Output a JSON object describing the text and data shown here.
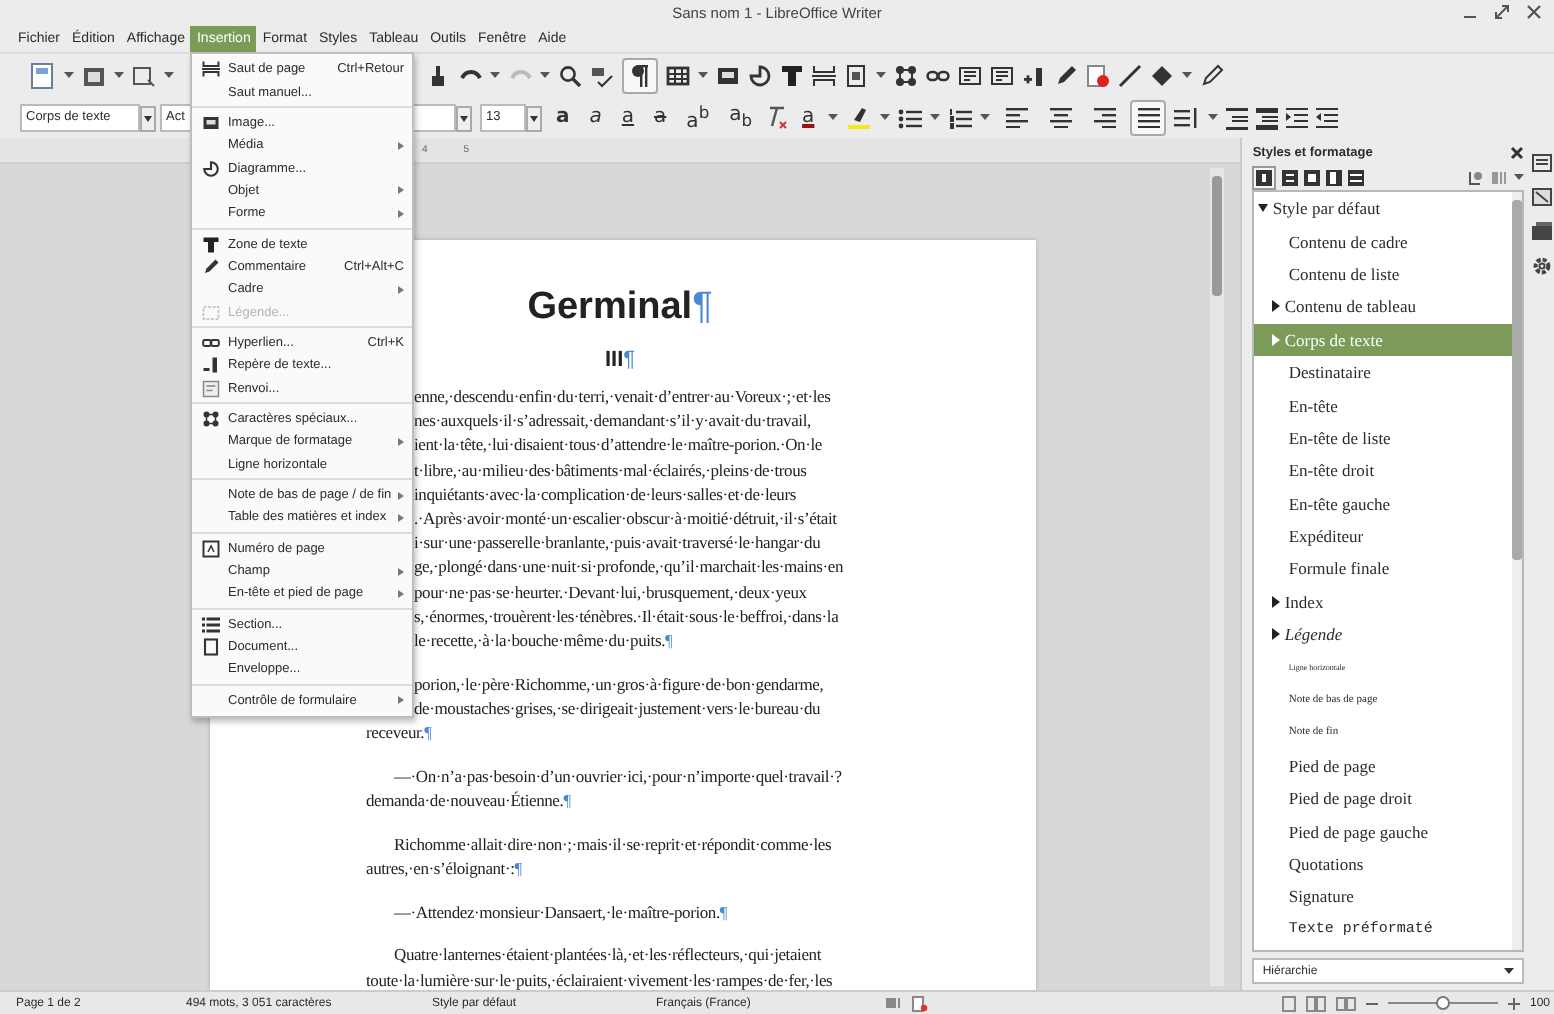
{
  "window": {
    "title": "Sans nom 1 - LibreOffice Writer"
  },
  "menubar": [
    {
      "label": "Fichier",
      "selected": false
    },
    {
      "label": "Édition",
      "selected": false
    },
    {
      "label": "Affichage",
      "selected": false
    },
    {
      "label": "Insertion",
      "selected": true
    },
    {
      "label": "Format",
      "selected": false
    },
    {
      "label": "Styles",
      "selected": false
    },
    {
      "label": "Tableau",
      "selected": false
    },
    {
      "label": "Outils",
      "selected": false
    },
    {
      "label": "Fenêtre",
      "selected": false
    },
    {
      "label": "Aide",
      "selected": false
    }
  ],
  "toolbar": {
    "formatting_marks_on": true,
    "paragraph_style": "Corps de texte",
    "font_name": "Act",
    "font_size": "13",
    "format_buttons": [
      {
        "label": "a",
        "kind": "bold"
      },
      {
        "label": "a",
        "kind": "italic"
      },
      {
        "label": "a",
        "kind": "underline"
      },
      {
        "label": "a",
        "kind": "strike"
      },
      {
        "label": "a$^{b}$",
        "kind": "super"
      },
      {
        "label": "a$_{b}$",
        "kind": "sub"
      },
      {
        "label": "a",
        "kind": "font-color"
      }
    ],
    "align": [
      {
        "kind": "left",
        "selected": false
      },
      {
        "kind": "center",
        "selected": false
      },
      {
        "kind": "right",
        "selected": false
      },
      {
        "kind": "justify",
        "selected": true
      }
    ]
  },
  "ruler": [
    "4",
    "5"
  ],
  "menu": [
    {
      "kind": "pagebreak",
      "label": "Saut de page",
      "shortcut": "Ctrl+Retour",
      "disabled": false
    },
    {
      "kind": "plain",
      "label": "Saut manuel...",
      "disabled": false
    },
    {
      "kind": "separator"
    },
    {
      "kind": "image",
      "label": "Image...",
      "disabled": false
    },
    {
      "kind": "plain",
      "label": "Média",
      "submenu": true,
      "disabled": false
    },
    {
      "kind": "chart",
      "label": "Diagramme...",
      "disabled": false
    },
    {
      "kind": "plain",
      "label": "Objet",
      "submenu": true,
      "disabled": false
    },
    {
      "kind": "plain",
      "label": "Forme",
      "submenu": true,
      "disabled": false
    },
    {
      "kind": "separator"
    },
    {
      "kind": "textbox",
      "label": "Zone de texte",
      "disabled": false
    },
    {
      "kind": "comment",
      "label": "Commentaire",
      "shortcut": "Ctrl+Alt+C",
      "disabled": false
    },
    {
      "kind": "plain",
      "label": "Cadre",
      "submenu": true,
      "disabled": false
    },
    {
      "kind": "caption",
      "label": "Légende...",
      "disabled": true
    },
    {
      "kind": "separator"
    },
    {
      "kind": "link",
      "label": "Hyperlien...",
      "shortcut": "Ctrl+K",
      "disabled": false
    },
    {
      "kind": "bookmark",
      "label": "Repère de texte...",
      "disabled": false
    },
    {
      "kind": "crossref",
      "label": "Renvoi...",
      "disabled": false
    },
    {
      "kind": "separator"
    },
    {
      "kind": "special",
      "label": "Caractères spéciaux...",
      "disabled": false
    },
    {
      "kind": "plain",
      "label": "Marque de formatage",
      "submenu": true,
      "disabled": false
    },
    {
      "kind": "plain",
      "label": "Ligne horizontale",
      "disabled": false
    },
    {
      "kind": "separator"
    },
    {
      "kind": "plain",
      "label": "Note de bas de page / de fin",
      "submenu": true,
      "disabled": false
    },
    {
      "kind": "plain",
      "label": "Table des matières et index",
      "submenu": true,
      "disabled": false
    },
    {
      "kind": "separator"
    },
    {
      "kind": "pagenumber",
      "label": "Numéro de page",
      "disabled": false
    },
    {
      "kind": "plain",
      "label": "Champ",
      "submenu": true,
      "disabled": false
    },
    {
      "kind": "plain",
      "label": "En-tête et pied de page",
      "submenu": true,
      "disabled": false
    },
    {
      "kind": "separator"
    },
    {
      "kind": "section",
      "label": "Section...",
      "disabled": false
    },
    {
      "kind": "document",
      "label": "Document...",
      "disabled": false
    },
    {
      "kind": "plain",
      "label": "Enveloppe...",
      "disabled": false
    },
    {
      "kind": "separator"
    },
    {
      "kind": "plain",
      "label": "Contrôle de formulaire",
      "submenu": true,
      "disabled": false
    }
  ],
  "document": {
    "title": "Germinal",
    "title_mark": "¶",
    "chapter": "III",
    "chapter_mark": "¶",
    "paragraphs": [
      {
        "indent": false,
        "mark": "¶",
        "lines": [
          {
            "text": "enne,·descendu·enfin·du·terri,·venait·d’entrer·au·Voreux·;·et·les",
            "cut": true
          },
          {
            "text": "nes·auxquels·il·s’adressait,·demandant·s’il·y·avait·du·travail,",
            "cut": true
          },
          {
            "text": "ient·la·tête,·lui·disaient·tous·d’attendre·le·maître-porion.·On·le",
            "cut": true
          },
          {
            "text": "t·libre,·au·milieu·des·bâtiments·mal·éclairés,·pleins·de·trous",
            "cut": true
          },
          {
            "text": "inquiétants·avec·la·complication·de·leurs·salles·et·de·leurs",
            "cut": true
          },
          {
            "text": ".·Après·avoir·monté·un·escalier·obscur·à·moitié·détruit,·il·s’était",
            "cut": true
          },
          {
            "text": "i·sur·une·passerelle·branlante,·puis·avait·traversé·le·hangar·du",
            "cut": true
          },
          {
            "text": "ge,·plongé·dans·une·nuit·si·profonde,·qu’il·marchait·les·mains·en",
            "cut": true
          },
          {
            "text": "pour·ne·pas·se·heurter.·Devant·lui,·brusquement,·deux·yeux",
            "cut": true
          },
          {
            "text": "s,·énormes,·trouèrent·les·ténèbres.·Il·était·sous·le·beffroi,·dans·la",
            "cut": true
          },
          {
            "text": "le·recette,·à·la·bouche·même·du·puits.",
            "cut": true
          }
        ]
      },
      {
        "indent": false,
        "mark": "¶",
        "lines": [
          {
            "text": "porion,·le·père·Richomme,·un·gros·à·figure·de·bon·gendarme,",
            "cut": true
          },
          {
            "text": "de·moustaches·grises,·se·dirigeait·justement·vers·le·bureau·du",
            "cut": true
          },
          {
            "text": "receveur.",
            "cut": false
          }
        ]
      },
      {
        "indent": true,
        "mark": "¶",
        "lines": [
          {
            "text": "—·On·n’a·pas·besoin·d’un·ouvrier·ici,·pour·n’importe·quel·travail·?",
            "cut": false
          },
          {
            "text": "demanda·de·nouveau·Étienne.",
            "cut": false
          }
        ]
      },
      {
        "indent": true,
        "mark": "¶",
        "lines": [
          {
            "text": "Richomme·allait·dire·non·;·mais·il·se·reprit·et·répondit·comme·les",
            "cut": false
          },
          {
            "text": "autres,·en·s’éloignant·:",
            "cut": false
          }
        ]
      },
      {
        "indent": true,
        "mark": "¶",
        "lines": [
          {
            "text": "—·Attendez·monsieur·Dansaert,·le·maître-porion.",
            "cut": false
          }
        ]
      },
      {
        "indent": true,
        "lines": [
          {
            "text": "Quatre·lanternes·étaient·plantées·là,·et·les·réflecteurs,·qui·jetaient",
            "cut": false
          },
          {
            "text": "toute·la·lumière·sur·le·puits,·éclairaient·vivement·les·rampes·de·fer,·les",
            "cut": false
          }
        ]
      }
    ]
  },
  "sidebar": {
    "title": "Styles et formatage",
    "filter": "Hiérarchie",
    "styles": [
      {
        "label": "Style par défaut",
        "kind": "normal",
        "selected": false,
        "expanded": true,
        "children": [
          {
            "label": "Contenu de cadre",
            "kind": "normal",
            "selected": false
          },
          {
            "label": "Contenu de liste",
            "kind": "normal",
            "selected": false
          },
          {
            "label": "Contenu de tableau",
            "kind": "normal",
            "selected": false,
            "expanded": false
          },
          {
            "label": "Corps de texte",
            "kind": "normal",
            "selected": true,
            "expanded": false
          },
          {
            "label": "Destinataire",
            "kind": "normal",
            "selected": false
          },
          {
            "label": "En-tête",
            "kind": "normal",
            "selected": false
          },
          {
            "label": "En-tête de liste",
            "kind": "normal",
            "selected": false
          },
          {
            "label": "En-tête droit",
            "kind": "normal",
            "selected": false
          },
          {
            "label": "En-tête gauche",
            "kind": "normal",
            "selected": false
          },
          {
            "label": "Expéditeur",
            "kind": "normal",
            "selected": false
          },
          {
            "label": "Formule finale",
            "kind": "normal",
            "selected": false
          },
          {
            "label": "Index",
            "kind": "normal",
            "selected": false,
            "expanded": false
          },
          {
            "label": "Légende",
            "kind": "italic",
            "selected": false,
            "expanded": false
          },
          {
            "label": "Ligne horizontale",
            "kind": "tiny",
            "selected": false
          },
          {
            "label": "Note de bas de page",
            "kind": "small",
            "selected": false
          },
          {
            "label": "Note de fin",
            "kind": "small",
            "selected": false
          },
          {
            "label": "Pied de page",
            "kind": "normal",
            "selected": false
          },
          {
            "label": "Pied de page droit",
            "kind": "normal",
            "selected": false
          },
          {
            "label": "Pied de page gauche",
            "kind": "normal",
            "selected": false
          },
          {
            "label": "Quotations",
            "kind": "normal",
            "selected": false
          },
          {
            "label": "Signature",
            "kind": "normal",
            "selected": false
          },
          {
            "label": "Texte préformaté",
            "kind": "mono",
            "selected": false
          }
        ]
      }
    ]
  },
  "status_bar": {
    "page": "Page 1 de 2",
    "words": "494 mots, 3 051 caractères",
    "style": "Style par défaut",
    "language": "Français (France)",
    "zoom_slider": {
      "level": 0.5
    },
    "zoom": "100"
  }
}
